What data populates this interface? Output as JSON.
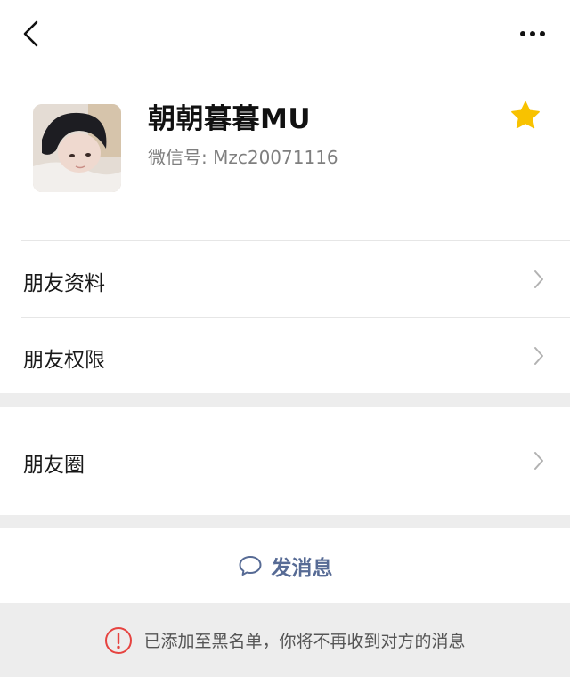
{
  "nav": {
    "back_icon": "chevron-left-icon",
    "more_icon": "more-dots-icon"
  },
  "profile": {
    "nickname": "朝朝暮暮MU",
    "wechat_id": "微信号: Mzc20071116",
    "star_icon": "star-icon",
    "star_color": "#f8c200"
  },
  "menu": {
    "friend_info": "朋友资料",
    "friend_permissions": "朋友权限",
    "moments": "朋友圈"
  },
  "actions": {
    "send_message": "发消息",
    "send_message_color": "#576b95"
  },
  "notice": {
    "text": "已添加至黑名单，你将不再收到对方的消息",
    "icon": "alert-circle-icon",
    "icon_color": "#e64340"
  }
}
